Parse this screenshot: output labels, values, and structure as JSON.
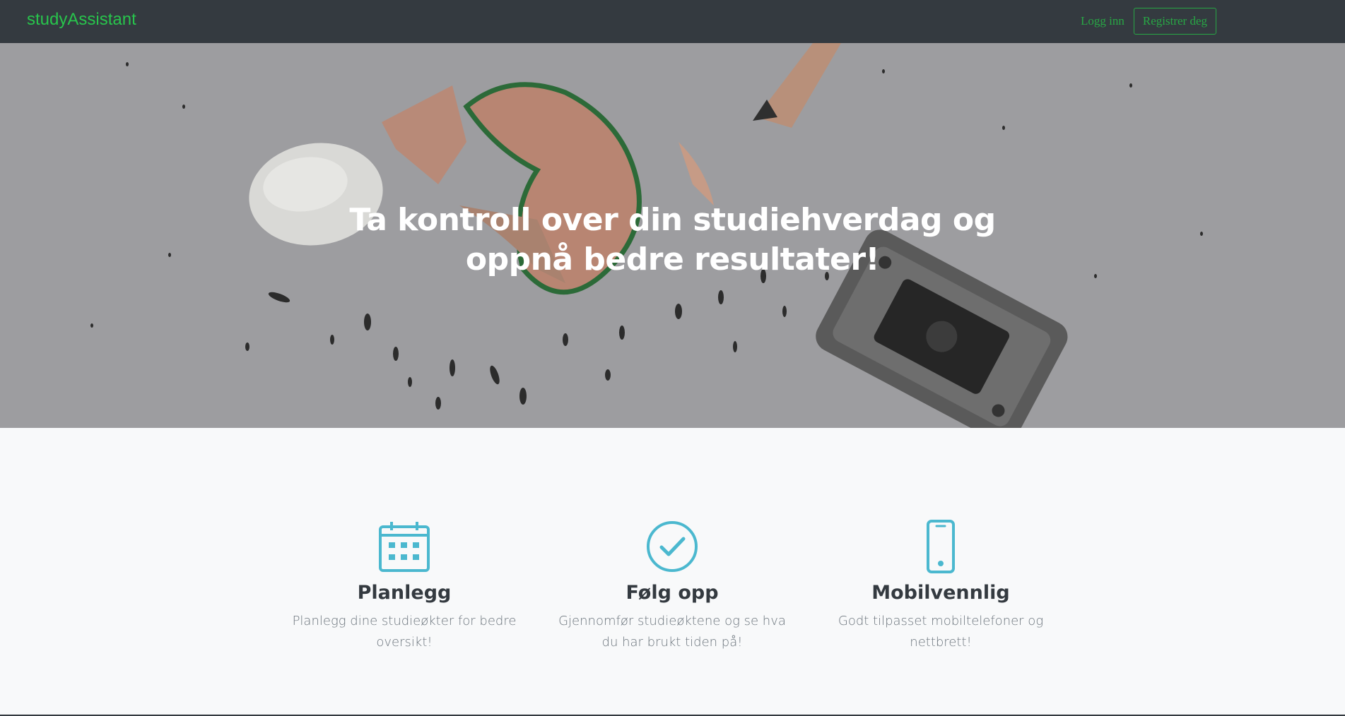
{
  "navbar": {
    "brand": "studyAssistant",
    "login_label": "Logg inn",
    "register_label": "Registrer deg"
  },
  "hero": {
    "title_line1": "Ta kontroll over din studiehverdag og",
    "title_line2": "oppnå bedre resultater!"
  },
  "features": [
    {
      "icon": "calendar-icon",
      "title": "Planlegg",
      "text_line1": "Planlegg dine studieøkter for bedre",
      "text_line2": "oversikt!"
    },
    {
      "icon": "check-circle-icon",
      "title": "Følg opp",
      "text_line1": "Gjennomfør studieøktene og se hva",
      "text_line2": "du har brukt tiden på!"
    },
    {
      "icon": "mobile-phone-icon",
      "title": "Mobilvennlig",
      "text_line1": "Godt tilpasset mobiltelefoner og",
      "text_line2": "nettbrett!"
    }
  ],
  "colors": {
    "navbar_bg": "#343a40",
    "accent_green": "#28a745",
    "brand_green": "#28c44c",
    "icon_teal": "#4bb8cf",
    "heading_dark": "#343a40",
    "text_muted": "#6c757d",
    "page_bg": "#f8f9fa"
  }
}
